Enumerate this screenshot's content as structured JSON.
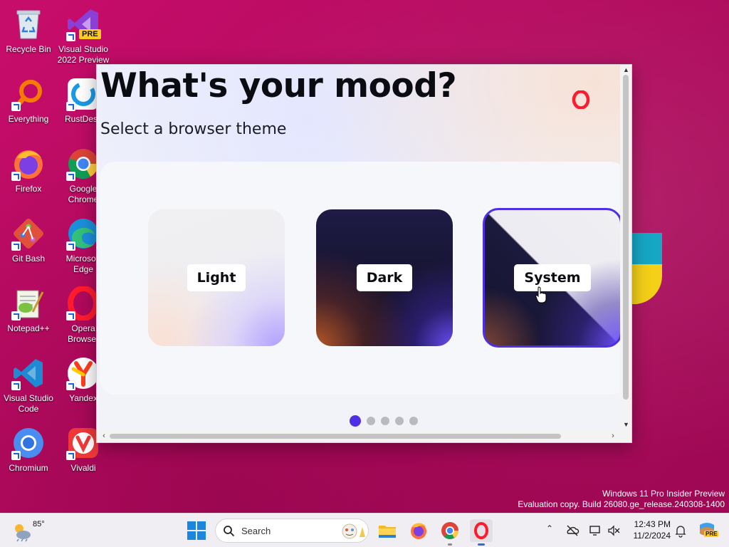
{
  "desktop": {
    "icons": [
      {
        "label": "Recycle Bin"
      },
      {
        "label": "Visual Studio 2022 Preview"
      },
      {
        "label": "Everything"
      },
      {
        "label": "RustDesk"
      },
      {
        "label": "Firefox"
      },
      {
        "label": "Google Chrome"
      },
      {
        "label": "Git Bash"
      },
      {
        "label": "Microsoft Edge"
      },
      {
        "label": "Notepad++"
      },
      {
        "label": "Opera Browser"
      },
      {
        "label": "Visual Studio Code"
      },
      {
        "label": "Yandex"
      },
      {
        "label": "Chromium"
      },
      {
        "label": "Vivaldi"
      }
    ],
    "vs_badge": "PRE"
  },
  "onboarding": {
    "title": "What's your mood?",
    "subtitle": "Select a browser theme",
    "themes": [
      {
        "label": "Light",
        "selected": false
      },
      {
        "label": "Dark",
        "selected": false
      },
      {
        "label": "System",
        "selected": true
      }
    ],
    "pager": {
      "total": 5,
      "current": 1
    },
    "accent_color": "#4e2fe6"
  },
  "watermark": {
    "line1": "Windows 11 Pro Insider Preview",
    "line2": "Evaluation copy. Build 26080.ge_release.240308-1400"
  },
  "taskbar": {
    "weather_temp": "85°",
    "search_placeholder": "Search",
    "pinned_apps": [
      "File Explorer",
      "Firefox",
      "Google Chrome",
      "Opera"
    ],
    "clock_time": "12:43 PM",
    "clock_date": "11/2/2024",
    "copilot_badge": "PRE"
  }
}
